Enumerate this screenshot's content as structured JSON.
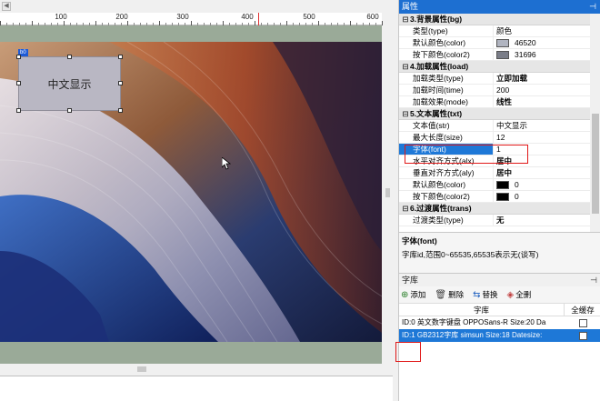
{
  "ruler": {
    "labels": [
      "100",
      "200",
      "300",
      "400",
      "500",
      "600"
    ]
  },
  "canvas": {
    "widget_text": "中文显示",
    "widget_id": "b0"
  },
  "properties": {
    "title": "属性",
    "groups": [
      {
        "label": "3.背景属性(bg)",
        "rows": [
          {
            "name": "类型(type)",
            "value": "颜色",
            "bold": false
          },
          {
            "name": "默认颜色(color)",
            "value": "46520",
            "swatch": "#b0b4c0"
          },
          {
            "name": "按下颜色(color2)",
            "value": "31696",
            "swatch": "#7a7d88"
          }
        ]
      },
      {
        "label": "4.加载属性(load)",
        "rows": [
          {
            "name": "加载类型(type)",
            "value": "立即加载",
            "bold": true
          },
          {
            "name": "加载时间(time)",
            "value": "200"
          },
          {
            "name": "加载效果(mode)",
            "value": "线性",
            "bold": true
          }
        ]
      },
      {
        "label": "5.文本属性(txt)",
        "rows": [
          {
            "name": "文本值(str)",
            "value": "中文显示"
          },
          {
            "name": "最大长度(size)",
            "value": "12"
          },
          {
            "name": "字体(font)",
            "value": "1",
            "selected": true
          },
          {
            "name": "水平对齐方式(alx)",
            "value": "居中",
            "bold": true
          },
          {
            "name": "垂直对齐方式(aly)",
            "value": "居中",
            "bold": true
          },
          {
            "name": "默认颜色(color)",
            "value": "0",
            "swatch": "#000000"
          },
          {
            "name": "按下颜色(color2)",
            "value": "0",
            "swatch": "#000000"
          }
        ]
      },
      {
        "label": "6.过渡属性(trans)",
        "rows": [
          {
            "name": "过渡类型(type)",
            "value": "无",
            "bold": true
          }
        ]
      }
    ]
  },
  "description": {
    "title": "字体(font)",
    "text": "字库id,范围0~65535,65535表示无(谈写)"
  },
  "font_library": {
    "title": "字库",
    "toolbar": {
      "add": "添加",
      "delete": "删除",
      "replace": "替换",
      "clear": "全删"
    },
    "columns": {
      "library": "字库",
      "cache": "全缓存"
    },
    "rows": [
      {
        "text": "ID:0 英文数字键盘 OPPOSans-R  Size:20 Da",
        "selected": false
      },
      {
        "text": "ID:1 GB2312字库 simsun  Size:18 Datesize:",
        "selected": true
      }
    ]
  },
  "colors": {
    "accent": "#1e78d7",
    "highlight": "#e01818"
  }
}
